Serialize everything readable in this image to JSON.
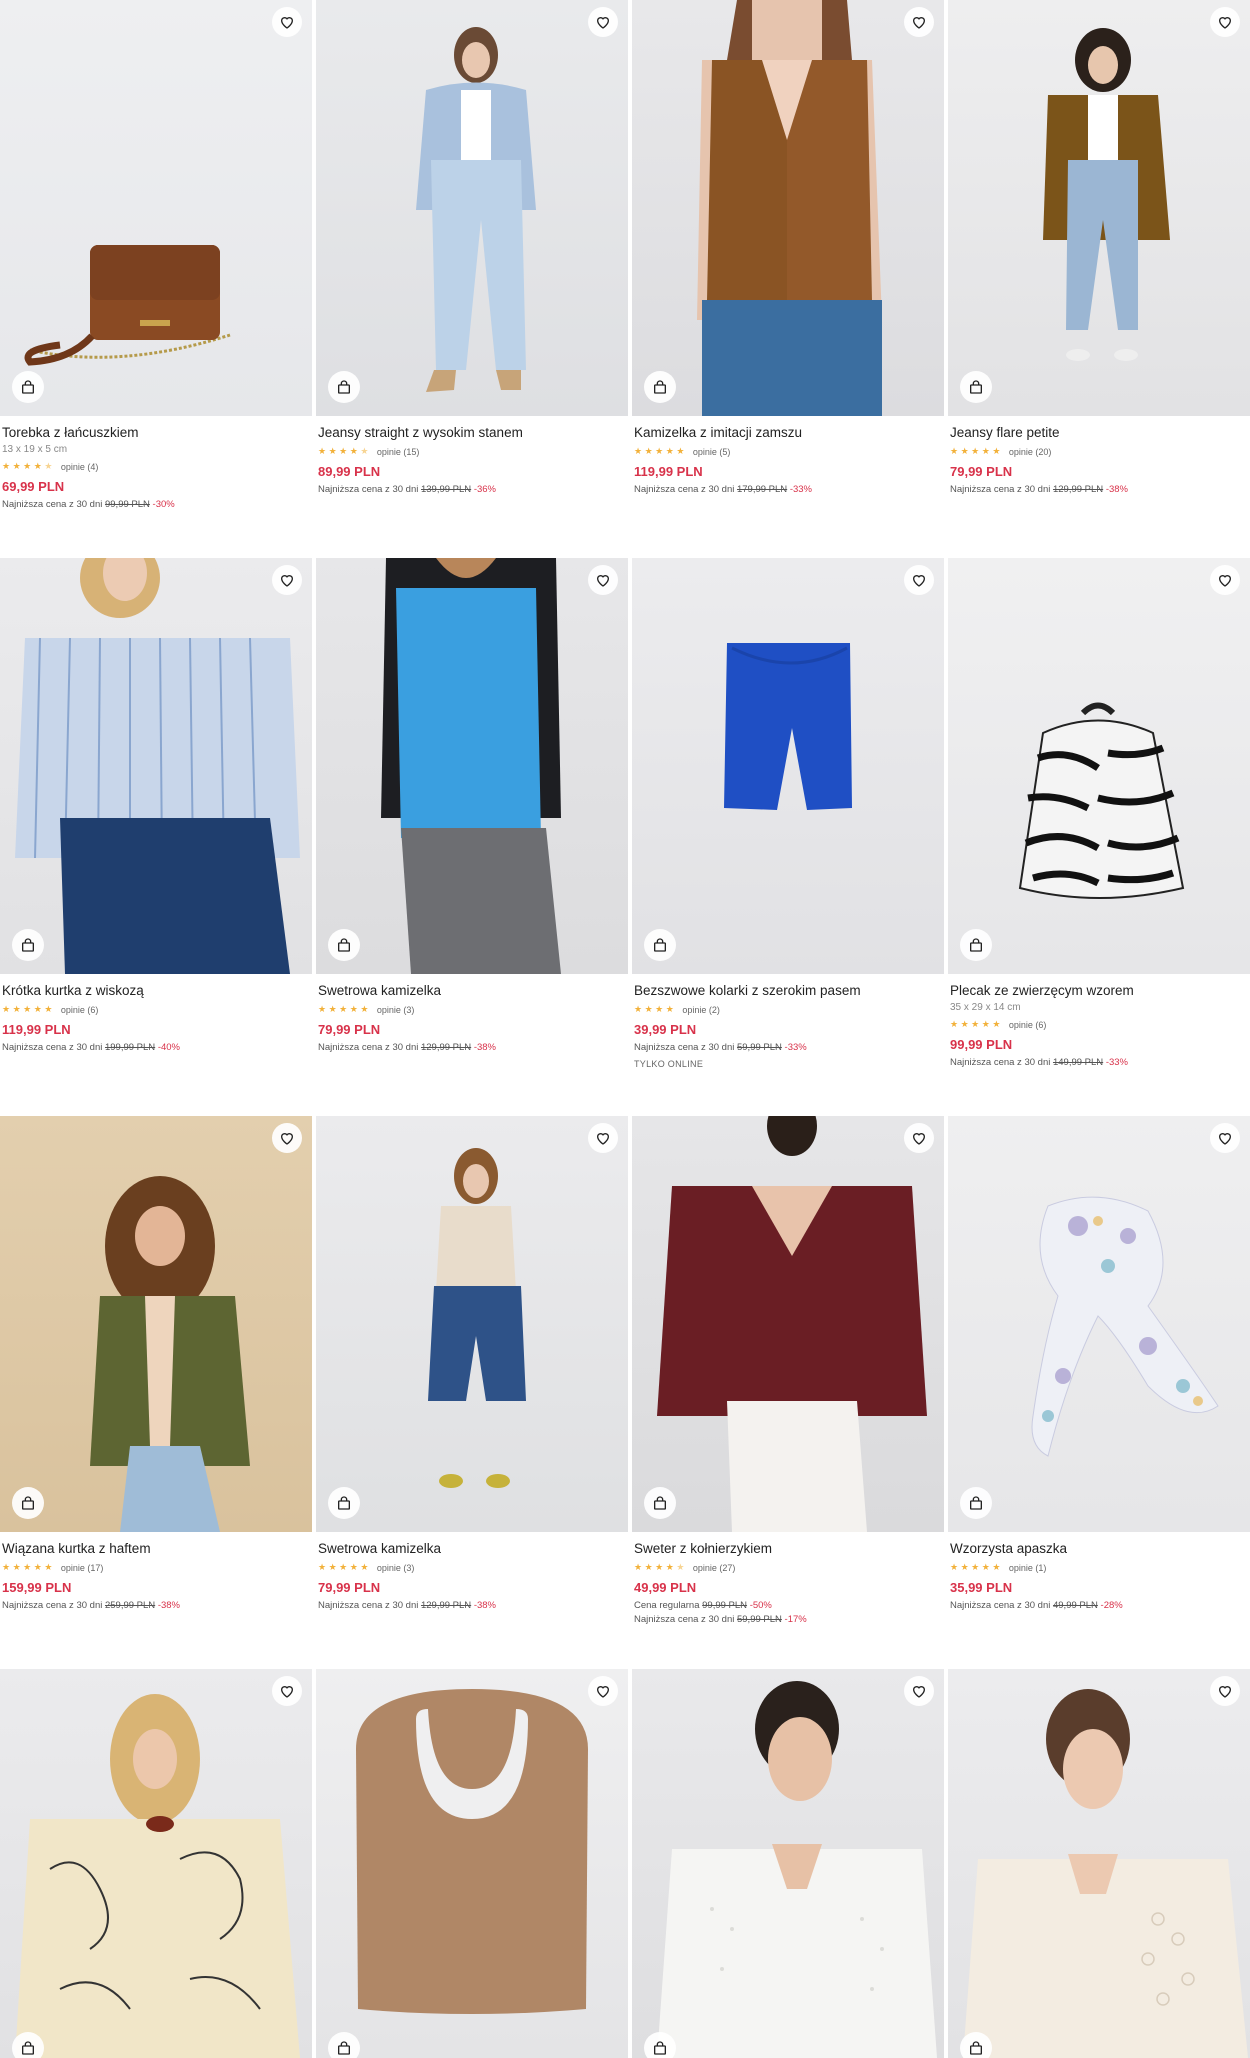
{
  "products": [
    {
      "name": "Torebka z łańcuszkiem",
      "dims": "13 x 19 x 5 cm",
      "stars": "★★★★★",
      "reviews": "opinie (4)",
      "price": "69,99 PLN",
      "lowest_label": "Najniższa cena z 30 dni",
      "old_price": "99,99 PLN",
      "discount": "-30%",
      "rating": 4.5
    },
    {
      "name": "Jeansy straight z wysokim stanem",
      "stars": "★★★★★",
      "reviews": "opinie (15)",
      "price": "89,99 PLN",
      "lowest_label": "Najniższa cena z 30 dni",
      "old_price": "139,99 PLN",
      "discount": "-36%",
      "rating": 4.5
    },
    {
      "name": "Kamizelka z imitacji zamszu",
      "stars": "★★★★★",
      "reviews": "opinie (5)",
      "price": "119,99 PLN",
      "lowest_label": "Najniższa cena z 30 dni",
      "old_price": "179,99 PLN",
      "discount": "-33%",
      "rating": 5
    },
    {
      "name": "Jeansy flare petite",
      "stars": "★★★★★",
      "reviews": "opinie (20)",
      "price": "79,99 PLN",
      "lowest_label": "Najniższa cena z 30 dni",
      "old_price": "129,99 PLN",
      "discount": "-38%",
      "rating": 5
    },
    {
      "name": "Krótka kurtka z wiskozą",
      "stars": "★★★★★",
      "reviews": "opinie (6)",
      "price": "119,99 PLN",
      "lowest_label": "Najniższa cena z 30 dni",
      "old_price": "199,99 PLN",
      "discount": "-40%",
      "rating": 5
    },
    {
      "name": "Swetrowa kamizelka",
      "stars": "★★★★★",
      "reviews": "opinie (3)",
      "price": "79,99 PLN",
      "lowest_label": "Najniższa cena z 30 dni",
      "old_price": "129,99 PLN",
      "discount": "-38%",
      "rating": 5
    },
    {
      "name": "Bezszwowe kolarki z szerokim pasem",
      "stars": "★★★★",
      "reviews": "opinie (2)",
      "price": "39,99 PLN",
      "lowest_label": "Najniższa cena z 30 dni",
      "old_price": "59,99 PLN",
      "discount": "-33%",
      "online": "TYLKO ONLINE",
      "rating": 4
    },
    {
      "name": "Plecak ze zwierzęcym wzorem",
      "dims": "35 x 29 x 14 cm",
      "stars": "★★★★★",
      "reviews": "opinie (6)",
      "price": "99,99 PLN",
      "lowest_label": "Najniższa cena z 30 dni",
      "old_price": "149,99 PLN",
      "discount": "-33%",
      "rating": 5
    },
    {
      "name": "Wiązana kurtka z haftem",
      "stars": "★★★★★",
      "reviews": "opinie (17)",
      "price": "159,99 PLN",
      "lowest_label": "Najniższa cena z 30 dni",
      "old_price": "259,99 PLN",
      "discount": "-38%",
      "rating": 5
    },
    {
      "name": "Swetrowa kamizelka",
      "stars": "★★★★★",
      "reviews": "opinie (3)",
      "price": "79,99 PLN",
      "lowest_label": "Najniższa cena z 30 dni",
      "old_price": "129,99 PLN",
      "discount": "-38%",
      "rating": 5
    },
    {
      "name": "Sweter z kołnierzykiem",
      "stars": "★★★★★",
      "reviews": "opinie (27)",
      "price": "49,99 PLN",
      "regular_label": "Cena regularna",
      "regular_old": "99,99 PLN",
      "regular_disc": "-50%",
      "lowest_label": "Najniższa cena z 30 dni",
      "old_price": "59,99 PLN",
      "discount": "-17%",
      "rating": 4.5
    },
    {
      "name": "Wzorzysta apaszka",
      "stars": "★★★★★",
      "reviews": "opinie (1)",
      "price": "35,99 PLN",
      "lowest_label": "Najniższa cena z 30 dni",
      "old_price": "49,99 PLN",
      "discount": "-28%",
      "rating": 5
    }
  ],
  "colors": {
    "accent_price": "#d8324a",
    "star": "#f2b13a"
  },
  "icons": {
    "favorite": "heart-icon",
    "add_to_cart": "shopping-bag-icon"
  }
}
